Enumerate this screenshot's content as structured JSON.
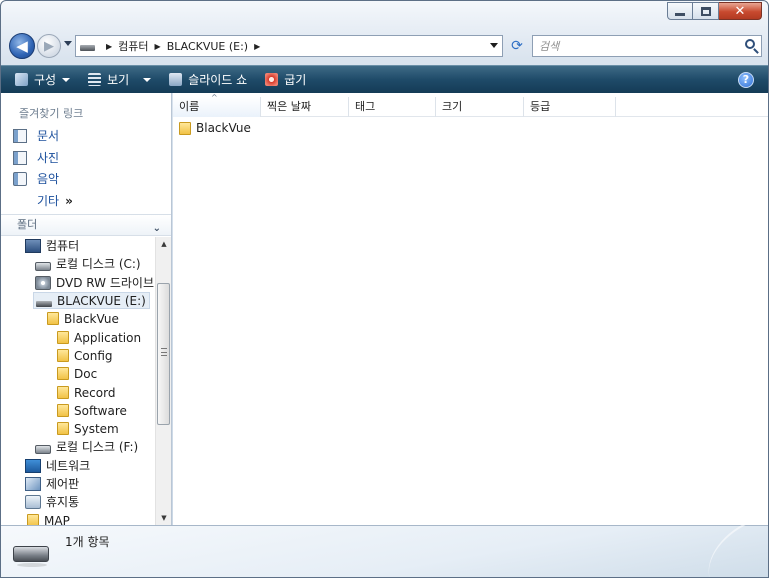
{
  "address": {
    "breadcrumbs": [
      "컴퓨터",
      "BLACKVUE (E:)"
    ],
    "search_placeholder": "검색"
  },
  "command_bar": {
    "organize": "구성",
    "views": "보기",
    "slideshow": "슬라이드 쇼",
    "burn": "굽기"
  },
  "favorites": {
    "title": "즐겨찾기 링크",
    "items": [
      "문서",
      "사진",
      "음악"
    ],
    "more": "기타",
    "more_glyph": "»"
  },
  "folders": {
    "title": "폴더",
    "tree": [
      {
        "label": "컴퓨터",
        "icon": "computer-icon"
      },
      {
        "label": "로컬 디스크 (C:)",
        "icon": "hard-drive-icon"
      },
      {
        "label": "DVD RW 드라이브",
        "icon": "dvd-drive-icon"
      },
      {
        "label": "BLACKVUE (E:)",
        "icon": "removable-drive-icon"
      },
      {
        "label": "BlackVue",
        "icon": "folder-icon"
      },
      {
        "label": "Application",
        "icon": "folder-icon"
      },
      {
        "label": "Config",
        "icon": "folder-icon"
      },
      {
        "label": "Doc",
        "icon": "folder-icon"
      },
      {
        "label": "Record",
        "icon": "folder-icon"
      },
      {
        "label": "Software",
        "icon": "folder-icon"
      },
      {
        "label": "System",
        "icon": "folder-icon"
      },
      {
        "label": "로컬 디스크 (F:)",
        "icon": "hard-drive-icon"
      },
      {
        "label": "네트워크",
        "icon": "network-icon"
      },
      {
        "label": "제어판",
        "icon": "control-panel-icon"
      },
      {
        "label": "휴지통",
        "icon": "recycle-bin-icon"
      },
      {
        "label": "MAP",
        "icon": "folder-icon"
      }
    ]
  },
  "columns": [
    "이름",
    "찍은 날짜",
    "태그",
    "크기",
    "등급"
  ],
  "files": [
    {
      "name": "BlackVue",
      "icon": "folder-icon"
    }
  ],
  "details": {
    "count": "1개 항목"
  },
  "colors": {
    "command_bar": "#1f4b69",
    "link_blue": "#1b4f9c",
    "folder_yellow": "#f1c246"
  }
}
